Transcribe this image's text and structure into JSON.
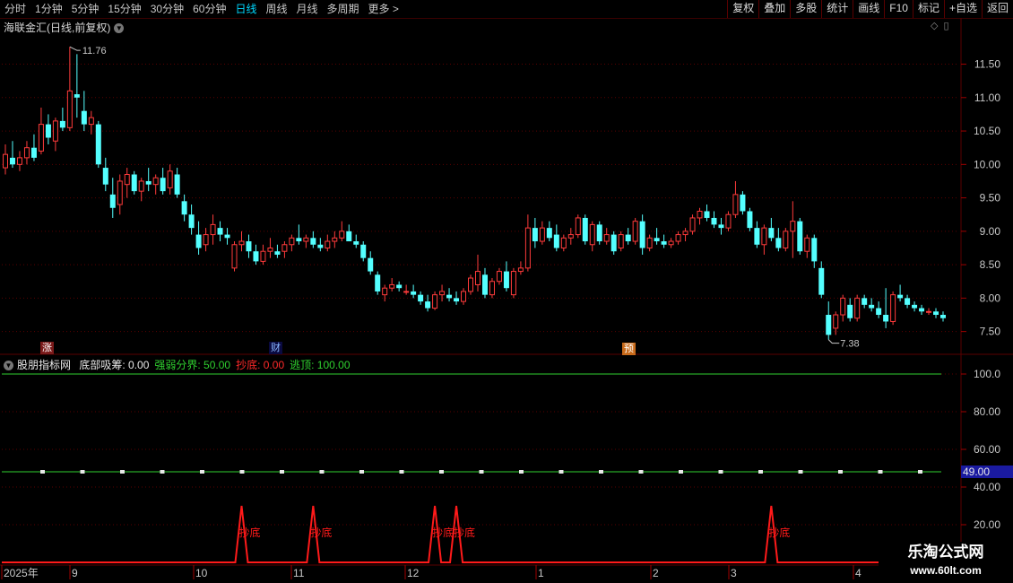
{
  "toolbar": {
    "tabs": [
      {
        "label": "分时",
        "active": false
      },
      {
        "label": "1分钟",
        "active": false
      },
      {
        "label": "5分钟",
        "active": false
      },
      {
        "label": "15分钟",
        "active": false
      },
      {
        "label": "30分钟",
        "active": false
      },
      {
        "label": "60分钟",
        "active": false
      },
      {
        "label": "日线",
        "active": true
      },
      {
        "label": "周线",
        "active": false
      },
      {
        "label": "月线",
        "active": false
      },
      {
        "label": "多周期",
        "active": false
      },
      {
        "label": "更多 >",
        "active": false
      }
    ],
    "buttons": [
      "复权",
      "叠加",
      "多股",
      "统计",
      "画线",
      "F10",
      "标记",
      "+自选",
      "返回"
    ]
  },
  "stock": {
    "title": "海联金汇(日线,前复权)",
    "high_label": "11.76",
    "low_label": "7.38"
  },
  "price_axis": {
    "ticks": [
      "11.50",
      "11.00",
      "10.50",
      "10.00",
      "9.50",
      "9.00",
      "8.50",
      "8.00",
      "7.50"
    ]
  },
  "event_markers": {
    "zhang": "涨",
    "cai": "财",
    "yu": "预"
  },
  "indicator": {
    "name": "股朋指标网",
    "items": [
      {
        "label": "底部吸筹: 0.00",
        "color": "#e8e8e8"
      },
      {
        "label": "强弱分界: 50.00",
        "color": "#2fd02f"
      },
      {
        "label": "抄底: 0.00",
        "color": "#ff2a2a"
      },
      {
        "label": "逃顶: 100.00",
        "color": "#2fd02f"
      }
    ],
    "axis_ticks": [
      "100.0",
      "80.00",
      "60.00",
      "40.00",
      "20.00"
    ],
    "current_value": "49.00",
    "signal_label": "抄底"
  },
  "time_axis": {
    "labels": [
      "2025年",
      "9",
      "10",
      "11",
      "12",
      "1",
      "2",
      "3",
      "4"
    ]
  },
  "brand": {
    "name": "乐淘公式网",
    "url": "www.60lt.com"
  },
  "colors": {
    "up": "#ff3b3b",
    "down": "#54ffff",
    "grid": "#5a0000",
    "line_green": "#2fd02f",
    "signal_red": "#ff1a1a",
    "value_box": "#1a1aa0"
  },
  "chart_data": {
    "type": "candlestick",
    "price_range": [
      7.2,
      11.95
    ],
    "high": 11.76,
    "low": 7.38,
    "ohlc": [
      [
        9.95,
        10.3,
        9.85,
        10.15
      ],
      [
        10.1,
        10.35,
        9.95,
        10.0
      ],
      [
        10.0,
        10.2,
        9.9,
        10.1
      ],
      [
        10.1,
        10.35,
        10.0,
        10.25
      ],
      [
        10.25,
        10.45,
        10.05,
        10.1
      ],
      [
        10.2,
        10.85,
        10.15,
        10.6
      ],
      [
        10.6,
        10.75,
        10.3,
        10.4
      ],
      [
        10.35,
        10.7,
        10.2,
        10.65
      ],
      [
        10.65,
        10.85,
        10.5,
        10.55
      ],
      [
        10.55,
        11.76,
        10.5,
        11.1
      ],
      [
        11.05,
        11.65,
        10.7,
        11.0
      ],
      [
        10.8,
        11.1,
        10.5,
        10.6
      ],
      [
        10.6,
        10.8,
        10.45,
        10.7
      ],
      [
        10.6,
        10.65,
        9.95,
        10.0
      ],
      [
        9.95,
        10.1,
        9.6,
        9.7
      ],
      [
        9.55,
        9.8,
        9.2,
        9.35
      ],
      [
        9.4,
        9.85,
        9.25,
        9.75
      ],
      [
        9.7,
        9.95,
        9.5,
        9.85
      ],
      [
        9.85,
        9.9,
        9.55,
        9.6
      ],
      [
        9.6,
        9.8,
        9.45,
        9.75
      ],
      [
        9.75,
        9.95,
        9.6,
        9.7
      ],
      [
        9.7,
        9.85,
        9.55,
        9.8
      ],
      [
        9.8,
        9.95,
        9.55,
        9.6
      ],
      [
        9.65,
        10.0,
        9.55,
        9.9
      ],
      [
        9.85,
        9.95,
        9.5,
        9.55
      ],
      [
        9.45,
        9.55,
        9.15,
        9.25
      ],
      [
        9.25,
        9.4,
        8.95,
        9.05
      ],
      [
        8.95,
        9.15,
        8.65,
        8.75
      ],
      [
        8.8,
        9.05,
        8.7,
        8.95
      ],
      [
        8.95,
        9.25,
        8.8,
        9.1
      ],
      [
        9.05,
        9.15,
        8.85,
        8.95
      ],
      [
        8.95,
        9.05,
        8.8,
        8.9
      ],
      [
        8.45,
        8.85,
        8.4,
        8.8
      ],
      [
        8.8,
        9.0,
        8.7,
        8.85
      ],
      [
        8.85,
        8.95,
        8.6,
        8.7
      ],
      [
        8.7,
        8.8,
        8.5,
        8.55
      ],
      [
        8.55,
        8.8,
        8.5,
        8.7
      ],
      [
        8.7,
        8.9,
        8.6,
        8.75
      ],
      [
        8.7,
        8.8,
        8.6,
        8.65
      ],
      [
        8.7,
        8.85,
        8.6,
        8.8
      ],
      [
        8.8,
        8.95,
        8.7,
        8.9
      ],
      [
        8.9,
        9.1,
        8.8,
        8.85
      ],
      [
        8.85,
        8.95,
        8.75,
        8.9
      ],
      [
        8.9,
        9.0,
        8.75,
        8.8
      ],
      [
        8.8,
        8.9,
        8.7,
        8.75
      ],
      [
        8.75,
        8.95,
        8.7,
        8.85
      ],
      [
        8.85,
        9.0,
        8.75,
        8.9
      ],
      [
        8.9,
        9.15,
        8.85,
        9.0
      ],
      [
        9.0,
        9.1,
        8.85,
        8.85
      ],
      [
        8.85,
        8.95,
        8.75,
        8.8
      ],
      [
        8.8,
        8.85,
        8.55,
        8.6
      ],
      [
        8.6,
        8.7,
        8.35,
        8.4
      ],
      [
        8.35,
        8.4,
        8.05,
        8.1
      ],
      [
        8.05,
        8.2,
        7.95,
        8.15
      ],
      [
        8.15,
        8.3,
        8.1,
        8.2
      ],
      [
        8.2,
        8.25,
        8.1,
        8.15
      ],
      [
        8.1,
        8.2,
        8.05,
        8.1
      ],
      [
        8.1,
        8.2,
        8.0,
        8.05
      ],
      [
        8.05,
        8.1,
        7.9,
        7.95
      ],
      [
        7.95,
        8.05,
        7.8,
        7.85
      ],
      [
        7.85,
        8.1,
        7.82,
        8.05
      ],
      [
        8.05,
        8.2,
        7.95,
        8.1
      ],
      [
        8.05,
        8.15,
        7.95,
        8.0
      ],
      [
        8.0,
        8.1,
        7.9,
        7.95
      ],
      [
        7.95,
        8.15,
        7.9,
        8.1
      ],
      [
        8.1,
        8.35,
        8.05,
        8.3
      ],
      [
        8.2,
        8.65,
        8.1,
        8.4
      ],
      [
        8.35,
        8.45,
        8.0,
        8.05
      ],
      [
        8.05,
        8.3,
        8.0,
        8.25
      ],
      [
        8.25,
        8.45,
        8.2,
        8.4
      ],
      [
        8.4,
        8.55,
        8.1,
        8.15
      ],
      [
        8.05,
        8.45,
        8.0,
        8.4
      ],
      [
        8.4,
        8.55,
        8.35,
        8.45
      ],
      [
        8.45,
        9.25,
        8.4,
        9.05
      ],
      [
        9.05,
        9.2,
        8.75,
        8.85
      ],
      [
        8.85,
        9.15,
        8.8,
        9.05
      ],
      [
        9.05,
        9.15,
        8.85,
        8.9
      ],
      [
        8.95,
        9.1,
        8.7,
        8.75
      ],
      [
        8.75,
        8.95,
        8.7,
        8.9
      ],
      [
        8.9,
        9.05,
        8.8,
        8.95
      ],
      [
        8.95,
        9.25,
        8.9,
        9.2
      ],
      [
        9.2,
        9.25,
        8.8,
        8.85
      ],
      [
        8.8,
        9.15,
        8.7,
        9.1
      ],
      [
        9.1,
        9.15,
        8.8,
        8.85
      ],
      [
        8.85,
        9.05,
        8.8,
        8.95
      ],
      [
        8.95,
        9.0,
        8.65,
        8.7
      ],
      [
        8.75,
        9.0,
        8.7,
        8.95
      ],
      [
        8.95,
        9.05,
        8.8,
        8.85
      ],
      [
        8.85,
        9.2,
        8.8,
        9.15
      ],
      [
        9.15,
        9.25,
        8.65,
        8.75
      ],
      [
        8.75,
        8.95,
        8.7,
        8.9
      ],
      [
        8.9,
        9.05,
        8.8,
        8.85
      ],
      [
        8.85,
        8.95,
        8.75,
        8.8
      ],
      [
        8.8,
        8.9,
        8.75,
        8.85
      ],
      [
        8.85,
        9.0,
        8.8,
        8.95
      ],
      [
        8.95,
        9.05,
        8.85,
        9.0
      ],
      [
        9.0,
        9.25,
        8.95,
        9.2
      ],
      [
        9.2,
        9.35,
        9.1,
        9.3
      ],
      [
        9.3,
        9.4,
        9.15,
        9.2
      ],
      [
        9.2,
        9.3,
        9.05,
        9.1
      ],
      [
        9.1,
        9.2,
        8.95,
        9.05
      ],
      [
        9.05,
        9.3,
        9.0,
        9.25
      ],
      [
        9.25,
        9.75,
        9.2,
        9.55
      ],
      [
        9.55,
        9.6,
        9.25,
        9.3
      ],
      [
        9.3,
        9.35,
        9.0,
        9.05
      ],
      [
        9.05,
        9.15,
        8.75,
        8.8
      ],
      [
        8.8,
        9.1,
        8.65,
        9.05
      ],
      [
        9.05,
        9.2,
        8.85,
        8.9
      ],
      [
        8.9,
        9.05,
        8.7,
        8.75
      ],
      [
        8.75,
        9.05,
        8.7,
        9.0
      ],
      [
        9.0,
        9.45,
        8.6,
        9.15
      ],
      [
        9.15,
        9.2,
        8.65,
        8.7
      ],
      [
        8.7,
        8.95,
        8.6,
        8.9
      ],
      [
        8.9,
        8.95,
        8.45,
        8.55
      ],
      [
        8.45,
        8.55,
        8.0,
        8.05
      ],
      [
        7.75,
        7.95,
        7.38,
        7.45
      ],
      [
        7.55,
        7.8,
        7.45,
        7.75
      ],
      [
        7.75,
        8.05,
        7.65,
        8.0
      ],
      [
        7.9,
        8.0,
        7.65,
        7.7
      ],
      [
        7.7,
        8.05,
        7.65,
        8.0
      ],
      [
        8.0,
        8.05,
        7.85,
        7.9
      ],
      [
        7.9,
        8.0,
        7.8,
        7.85
      ],
      [
        7.85,
        7.95,
        7.7,
        7.75
      ],
      [
        7.75,
        8.15,
        7.55,
        7.65
      ],
      [
        7.65,
        8.1,
        7.6,
        8.05
      ],
      [
        8.05,
        8.2,
        7.95,
        8.0
      ],
      [
        8.0,
        8.05,
        7.85,
        7.9
      ],
      [
        7.9,
        7.95,
        7.8,
        7.85
      ],
      [
        7.85,
        7.9,
        7.75,
        7.8
      ],
      [
        7.8,
        7.85,
        7.75,
        7.8
      ],
      [
        7.8,
        7.85,
        7.7,
        7.75
      ],
      [
        7.75,
        7.8,
        7.65,
        7.7
      ]
    ],
    "indicator_series": {
      "strength_line": 50,
      "top_line": 100,
      "bottom_signal_days": [
        33,
        43,
        60,
        63,
        107
      ]
    }
  }
}
